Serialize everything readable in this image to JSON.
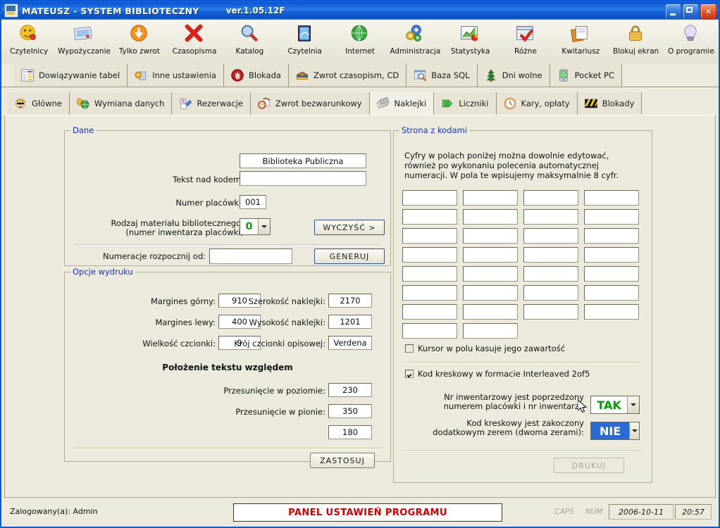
{
  "window": {
    "app_icon": "library-app-icon",
    "title": "MATEUSZ - SYSTEM BIBLIOTECZNY",
    "version": "ver.1.05.12F",
    "minimize_label": "minimize-icon",
    "maximize_label": "maximize-icon",
    "close_label": "✕"
  },
  "toolbar": {
    "items": [
      {
        "label": "Czytelnicy",
        "icon": "reader-face-icon"
      },
      {
        "label": "Wypożyczanie",
        "icon": "loan-card-icon"
      },
      {
        "label": "Tylko zwrot",
        "icon": "return-down-arrow-icon"
      },
      {
        "label": "Czasopisma",
        "icon": "red-x-icon"
      },
      {
        "label": "Katalog",
        "icon": "magnifier-icon"
      },
      {
        "label": "Czytelnia",
        "icon": "book-cover-icon"
      },
      {
        "label": "Internet",
        "icon": "globe-icon"
      },
      {
        "label": "Administracja",
        "icon": "gears-icon"
      },
      {
        "label": "Statystyka",
        "icon": "chart-icon"
      },
      {
        "label": "Różne",
        "icon": "calendar-check-icon"
      },
      {
        "label": "Kwitariusz",
        "icon": "documents-icon"
      },
      {
        "label": "Blokuj ekran",
        "icon": "padlock-icon"
      },
      {
        "label": "O programie",
        "icon": "lightbulb-icon"
      }
    ]
  },
  "tabs_row1": [
    {
      "label": "Dowiązywanie tabel",
      "icon": "table-link-icon",
      "active": false
    },
    {
      "label": "Inne ustawienia",
      "icon": "gear-box-icon",
      "active": false
    },
    {
      "label": "Blokada",
      "icon": "stop-hand-icon",
      "active": false
    },
    {
      "label": "Zwrot czasopism, CD",
      "icon": "books-icon",
      "active": false
    },
    {
      "label": "Baza SQL",
      "icon": "sql-search-icon",
      "active": false
    },
    {
      "label": "Dni wolne",
      "icon": "christmas-tree-icon",
      "active": false
    },
    {
      "label": "Pocket PC",
      "icon": "pda-icon",
      "active": false
    }
  ],
  "tabs_row2": [
    {
      "label": "Główne",
      "icon": "boy-face-icon",
      "active": false
    },
    {
      "label": "Wymiana danych",
      "icon": "phone-globe-icon",
      "active": false
    },
    {
      "label": "Rezerwacje",
      "icon": "clock-pen-icon",
      "active": false
    },
    {
      "label": "Zwrot bezwarunkowy",
      "icon": "return-doc-icon",
      "active": false
    },
    {
      "label": "Naklejki",
      "icon": "labels-icon",
      "active": true
    },
    {
      "label": "Liczniki",
      "icon": "counter-icon",
      "active": false
    },
    {
      "label": "Kary, opłaty",
      "icon": "clock-icon",
      "active": false
    },
    {
      "label": "Blokady",
      "icon": "hazard-stripes-icon",
      "active": false
    }
  ],
  "dane": {
    "legend": "Dane",
    "text_above_code_label": "Tekst nad kodem:",
    "text_above_code_value": "Biblioteka Publiczna",
    "text_above_code_value2": "",
    "branch_number_label": "Numer placówki:",
    "branch_number_value": "001",
    "material_type_label_line1": "Rodzaj materiału bibliotecznego:",
    "material_type_label_line2": "(numer inwentarza placówki)",
    "material_type_value": "0",
    "clear_button": "WYCZYŚĆ >",
    "numbering_from_label": "Numeracje rozpocznij od:",
    "numbering_from_value": "",
    "generate_button": "GENERUJ"
  },
  "opcje": {
    "legend": "Opcje wydruku",
    "margin_top_label": "Margines górny:",
    "margin_top_value": "910",
    "margin_left_label": "Margines lewy:",
    "margin_left_value": "400",
    "font_size_label": "Wielkość czcionki:",
    "font_size_value": "9",
    "label_width_label": "Szerokość naklejki:",
    "label_width_value": "2170",
    "label_height_label": "Wysokość naklejki:",
    "label_height_value": "1201",
    "font_face_label": "Krój czcionki opisowej:",
    "font_face_value": "Verdena",
    "position_heading": "Położenie tekstu względem",
    "offset_h_label": "Przesunięcie w poziomie:",
    "offset_h_value": "230",
    "offset_v_label": "Przesunięcie w pionie:",
    "offset_v_value": "350",
    "offset_extra_value": "180",
    "apply_button": "ZASTOSUJ"
  },
  "strona": {
    "legend": "Strona z kodami",
    "info_line1": "Cyfry w polach poniżej można dowolnie edytować,",
    "info_line2": "również po wykonaniu polecenia automatycznej",
    "info_line3": "numeracji. W pola te wpisujemy maksymalnie 8 cyfr.",
    "code_rows": [
      [
        "",
        "",
        "",
        ""
      ],
      [
        "",
        "",
        "",
        ""
      ],
      [
        "",
        "",
        "",
        ""
      ],
      [
        "",
        "",
        "",
        ""
      ],
      [
        "",
        "",
        "",
        ""
      ],
      [
        "",
        "",
        "",
        ""
      ],
      [
        "",
        "",
        "",
        ""
      ],
      [
        "",
        ""
      ]
    ],
    "cursor_clear_label": "Kursor w polu kasuje jego zawartość",
    "cursor_clear_checked": false,
    "interleaved_label": "Kod kreskowy w formacie Interleaved 2of5",
    "interleaved_checked": true,
    "prefix_label_line1": "Nr inwentarzowy jest poprzedzony",
    "prefix_label_line2": "numerem placówki i nr inwentarza",
    "prefix_value": "TAK",
    "suffix_label_line1": "Kod kreskowy jest zakoczony",
    "suffix_label_line2": "dodatkowym zerem (dwoma zerami):",
    "suffix_value": "NIE",
    "print_button": "DRUKUJ"
  },
  "statusbar": {
    "user": "Zalogowany(a): Admin",
    "banner": "PANEL USTAWIEŃ PROGRAMU",
    "caps": "CAPS",
    "num": "NUM",
    "date": "2006-10-11",
    "time": "20:57"
  },
  "colors": {
    "titlebar_blue": "#1567dd",
    "panel_bg": "#ece9dd",
    "legend_blue": "#1135c6",
    "banner_red": "#d60000",
    "tak_green": "#00a000",
    "nie_selected_blue": "#2a6ad4"
  }
}
